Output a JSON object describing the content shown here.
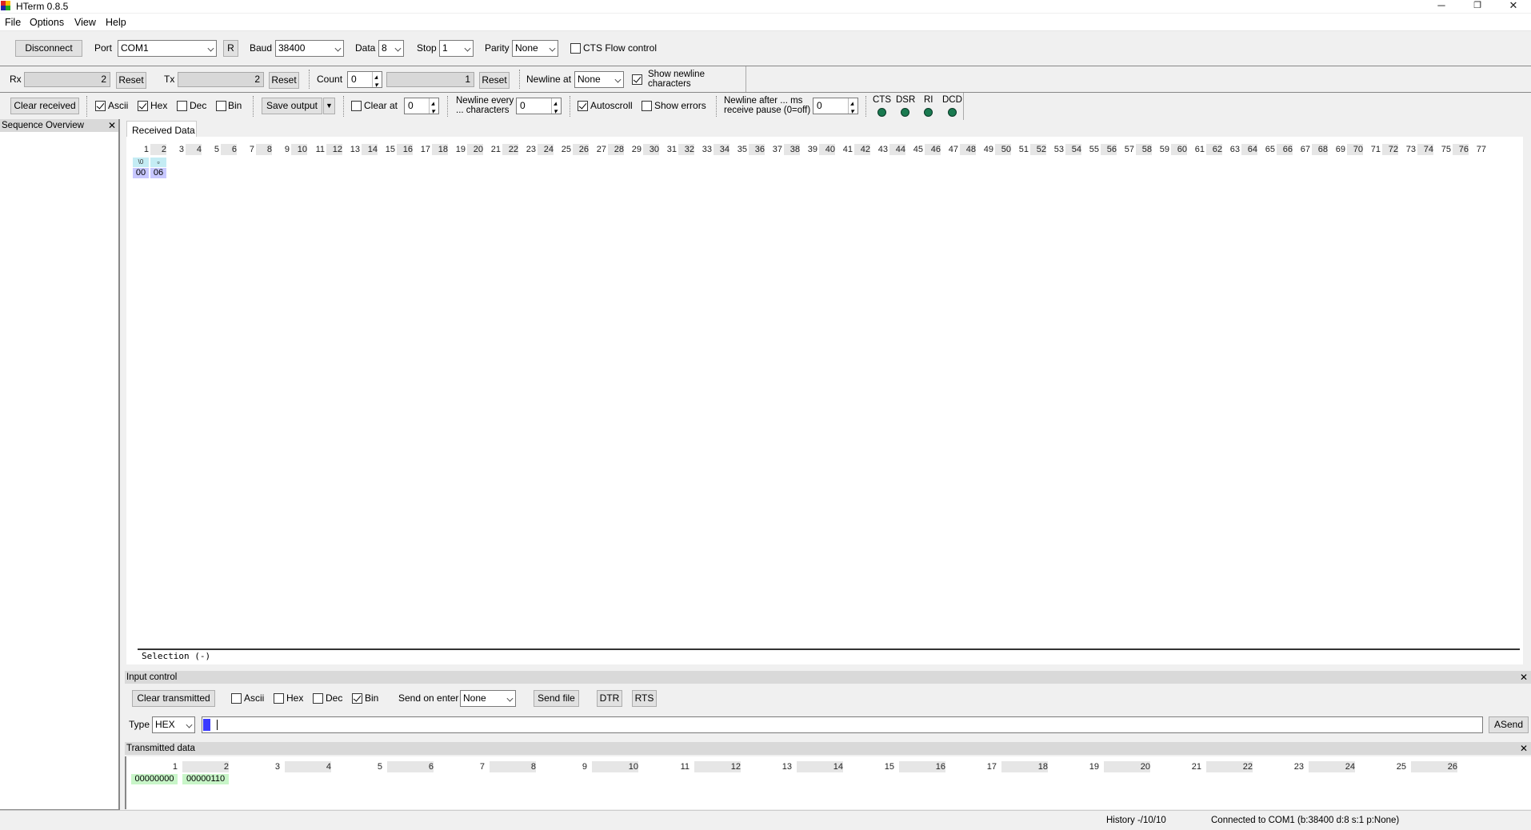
{
  "window": {
    "title": "HTerm 0.8.5",
    "minimize": "─",
    "restore": "❐",
    "close": "✕"
  },
  "menu": [
    "File",
    "Options",
    "View",
    "Help"
  ],
  "connection": {
    "disconnect_label": "Disconnect",
    "port_label": "Port",
    "port_value": "COM1",
    "r_label": "R",
    "baud_label": "Baud",
    "baud_value": "38400",
    "data_label": "Data",
    "data_value": "8",
    "stop_label": "Stop",
    "stop_value": "1",
    "parity_label": "Parity",
    "parity_value": "None",
    "cts_flow_label": "CTS Flow control",
    "cts_flow_checked": false
  },
  "counters": {
    "rx_label": "Rx",
    "rx_value": "2",
    "rx_reset": "Reset",
    "tx_label": "Tx",
    "tx_value": "2",
    "tx_reset": "Reset",
    "count_label": "Count",
    "count_value": "0",
    "count_field": "1",
    "count_reset": "Reset",
    "newline_at_label": "Newline at",
    "newline_at_value": "None",
    "show_newline_line1": "Show newline",
    "show_newline_line2": "characters",
    "show_newline_checked": true
  },
  "display": {
    "clear_received": "Clear received",
    "ascii": "Ascii",
    "ascii_checked": true,
    "hex": "Hex",
    "hex_checked": true,
    "dec": "Dec",
    "dec_checked": false,
    "bin": "Bin",
    "bin_checked": false,
    "save_output": "Save output",
    "clear_at_label": "Clear at",
    "clear_at_value": "0",
    "newline_every_line1": "Newline every",
    "newline_every_line2": "... characters",
    "newline_every_value": "0",
    "autoscroll": "Autoscroll",
    "autoscroll_checked": true,
    "show_errors": "Show errors",
    "show_errors_checked": false,
    "newline_after_line1": "Newline after ... ms",
    "newline_after_line2": "receive pause (0=off)",
    "newline_after_value": "0",
    "signals": [
      "CTS",
      "DSR",
      "RI",
      "DCD"
    ]
  },
  "sequence_overview": {
    "title": "Sequence Overview",
    "close": "✕"
  },
  "received": {
    "tab_label": "Received Data",
    "columns": [
      "1",
      "2",
      "3",
      "4",
      "5",
      "6",
      "7",
      "8",
      "9",
      "10",
      "11",
      "12",
      "13",
      "14",
      "15",
      "16",
      "17",
      "18",
      "19",
      "20",
      "21",
      "22",
      "23",
      "24",
      "25",
      "26",
      "27",
      "28",
      "29",
      "30",
      "31",
      "32",
      "33",
      "34",
      "35",
      "36",
      "37",
      "38",
      "39",
      "40",
      "41",
      "42",
      "43",
      "44",
      "45",
      "46",
      "47",
      "48",
      "49",
      "50",
      "51",
      "52",
      "53",
      "54",
      "55",
      "56",
      "57",
      "58",
      "59",
      "60",
      "61",
      "62",
      "63",
      "64",
      "65",
      "66",
      "67",
      "68",
      "69",
      "70",
      "71",
      "72",
      "73",
      "74",
      "75",
      "76",
      "77"
    ],
    "ascii_row": [
      "\\0",
      "▫"
    ],
    "hex_row": [
      "00",
      "06"
    ],
    "selection": "Selection (-)"
  },
  "input_control": {
    "title": "Input control",
    "close": "✕",
    "clear_transmitted": "Clear transmitted",
    "ascii": "Ascii",
    "ascii_checked": false,
    "hex": "Hex",
    "hex_checked": false,
    "dec": "Dec",
    "dec_checked": false,
    "bin": "Bin",
    "bin_checked": true,
    "send_on_enter_label": "Send on enter",
    "send_on_enter_value": "None",
    "send_file": "Send file",
    "dtr": "DTR",
    "rts": "RTS",
    "type_label": "Type",
    "type_value": "HEX",
    "asend": "ASend"
  },
  "transmitted": {
    "title": "Transmitted data",
    "close": "✕",
    "columns": [
      "1",
      "2",
      "3",
      "4",
      "5",
      "6",
      "7",
      "8",
      "9",
      "10",
      "11",
      "12",
      "13",
      "14",
      "15",
      "16",
      "17",
      "18",
      "19",
      "20",
      "21",
      "22",
      "23",
      "24",
      "25",
      "26"
    ],
    "values": [
      "00000000",
      "00000110"
    ]
  },
  "status": {
    "history": "History -/10/10",
    "connection": "Connected to COM1 (b:38400 d:8 s:1 p:None)"
  },
  "colors": {
    "ascii_bg": "#c4ecf4",
    "hex_bg": "#c8c8ff",
    "tx_bg": "#c8f5c8",
    "cursor": "#3b3bff",
    "led": "#1a7a50"
  }
}
